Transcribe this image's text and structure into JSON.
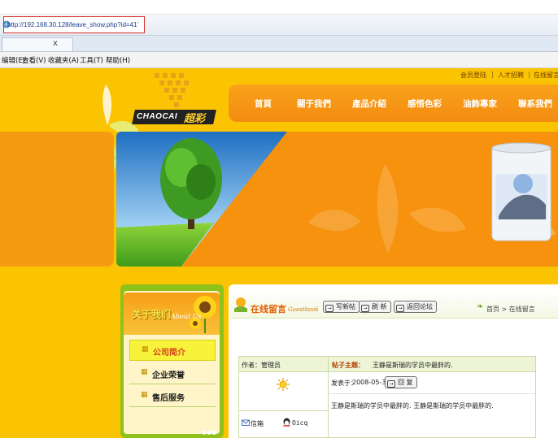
{
  "browser": {
    "url": "http://192.168.30.128/leave_show.php?id=41'",
    "tab_close": "x",
    "menu": [
      "编辑(E)",
      "查看(V)",
      "收藏夹(A)",
      "工具(T)",
      "帮助(H)"
    ]
  },
  "site": {
    "top_links": [
      "会员登陆",
      "人才招聘",
      "在线留言"
    ],
    "logo_en": "CHAOCAI",
    "logo_cn": "超彩",
    "nav": [
      "首頁",
      "關于我們",
      "產品介紹",
      "感悟色彩",
      "油飾專家",
      "聯系我們"
    ]
  },
  "sidebar": {
    "title_cn": "关于我们",
    "title_en": "About Us",
    "items": [
      "公司简介",
      "企业荣誉",
      "售后服务"
    ]
  },
  "guestbook": {
    "title_cn": "在线留言",
    "title_en": "Guestbook",
    "buttons": [
      "写新帖",
      "刷 新",
      "返回论坛"
    ],
    "crumb_home": "首页",
    "crumb_sep": ">",
    "crumb_current": "在线留言"
  },
  "message": {
    "author_label": "作者：管理员",
    "subject_label": "帖子主题：",
    "subject": "王静是斯瑞的学员中最胖的.",
    "posted_label": "发表于：",
    "posted_date": "2008-05-30",
    "reply_button": "回 复",
    "body": "王静是斯瑞的学员中最胖的. 王静是斯瑞的学员中最胖的.",
    "email_label": "信箱",
    "qq_label": "Oicq"
  },
  "colors": {
    "page_bg": "#fbc402",
    "nav_bg": "#f38b12",
    "sidebar_bg": "#8fc11b",
    "accent_red": "#d9302c"
  }
}
